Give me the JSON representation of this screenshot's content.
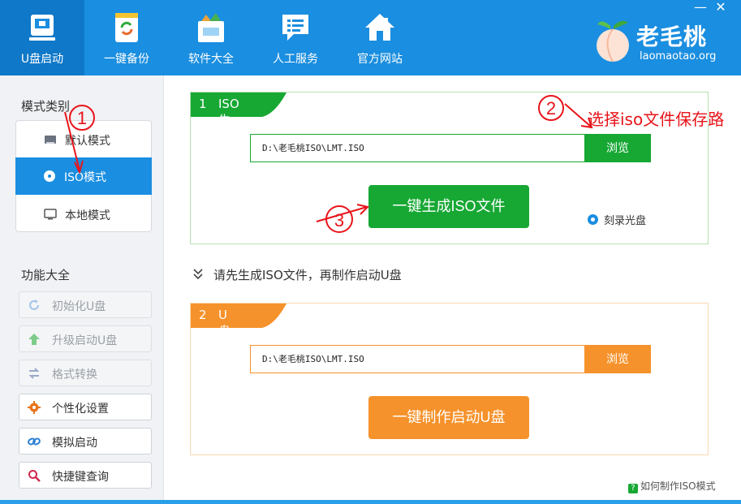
{
  "nav": {
    "items": [
      {
        "label": "U盘启动",
        "icon": "usb-boot-icon",
        "active": true
      },
      {
        "label": "一键备份",
        "icon": "backup-icon"
      },
      {
        "label": "软件大全",
        "icon": "software-icon"
      },
      {
        "label": "人工服务",
        "icon": "chat-service-icon"
      },
      {
        "label": "官方网站",
        "icon": "home-icon"
      }
    ],
    "minimize": "—",
    "close": "✕"
  },
  "brand": {
    "name": "老毛桃",
    "domain": "laomaotao.org",
    "icon": "peach-logo-icon"
  },
  "sidebar": {
    "mode_title": "模式类别",
    "modes": [
      {
        "label": "默认模式",
        "icon": "disk-icon"
      },
      {
        "label": "ISO模式",
        "icon": "cd-icon",
        "active": true
      },
      {
        "label": "本地模式",
        "icon": "monitor-icon"
      }
    ],
    "func_title": "功能大全",
    "functions": [
      {
        "label": "初始化U盘",
        "icon": "refresh-icon",
        "enabled": false
      },
      {
        "label": "升级启动U盘",
        "icon": "up-arrow-icon",
        "enabled": false
      },
      {
        "label": "格式转换",
        "icon": "swap-icon",
        "enabled": false
      },
      {
        "label": "个性化设置",
        "icon": "gear-icon",
        "enabled": true
      },
      {
        "label": "模拟启动",
        "icon": "link-icon",
        "enabled": true
      },
      {
        "label": "快捷键查询",
        "icon": "search-icon",
        "enabled": true
      }
    ]
  },
  "panel1": {
    "num": "1",
    "title": "ISO生成",
    "path": "D:\\老毛桃ISO\\LMT.ISO",
    "browse": "浏览",
    "action": "一键生成ISO文件",
    "burn_option": "刻录光盘"
  },
  "hint": "请先生成ISO文件，再制作启动U盘",
  "panel2": {
    "num": "2",
    "title": "U盘制作",
    "path": "D:\\老毛桃ISO\\LMT.ISO",
    "browse": "浏览",
    "action": "一键制作启动U盘"
  },
  "help_link": "如何制作ISO模式",
  "annotations": {
    "marker1": "1",
    "marker2": "2",
    "marker3": "3",
    "note": "选择iso文件保存路",
    "color": "#e8141a"
  },
  "colors": {
    "header": "#1a8ee0",
    "green": "#17a834",
    "orange": "#f6922b"
  }
}
